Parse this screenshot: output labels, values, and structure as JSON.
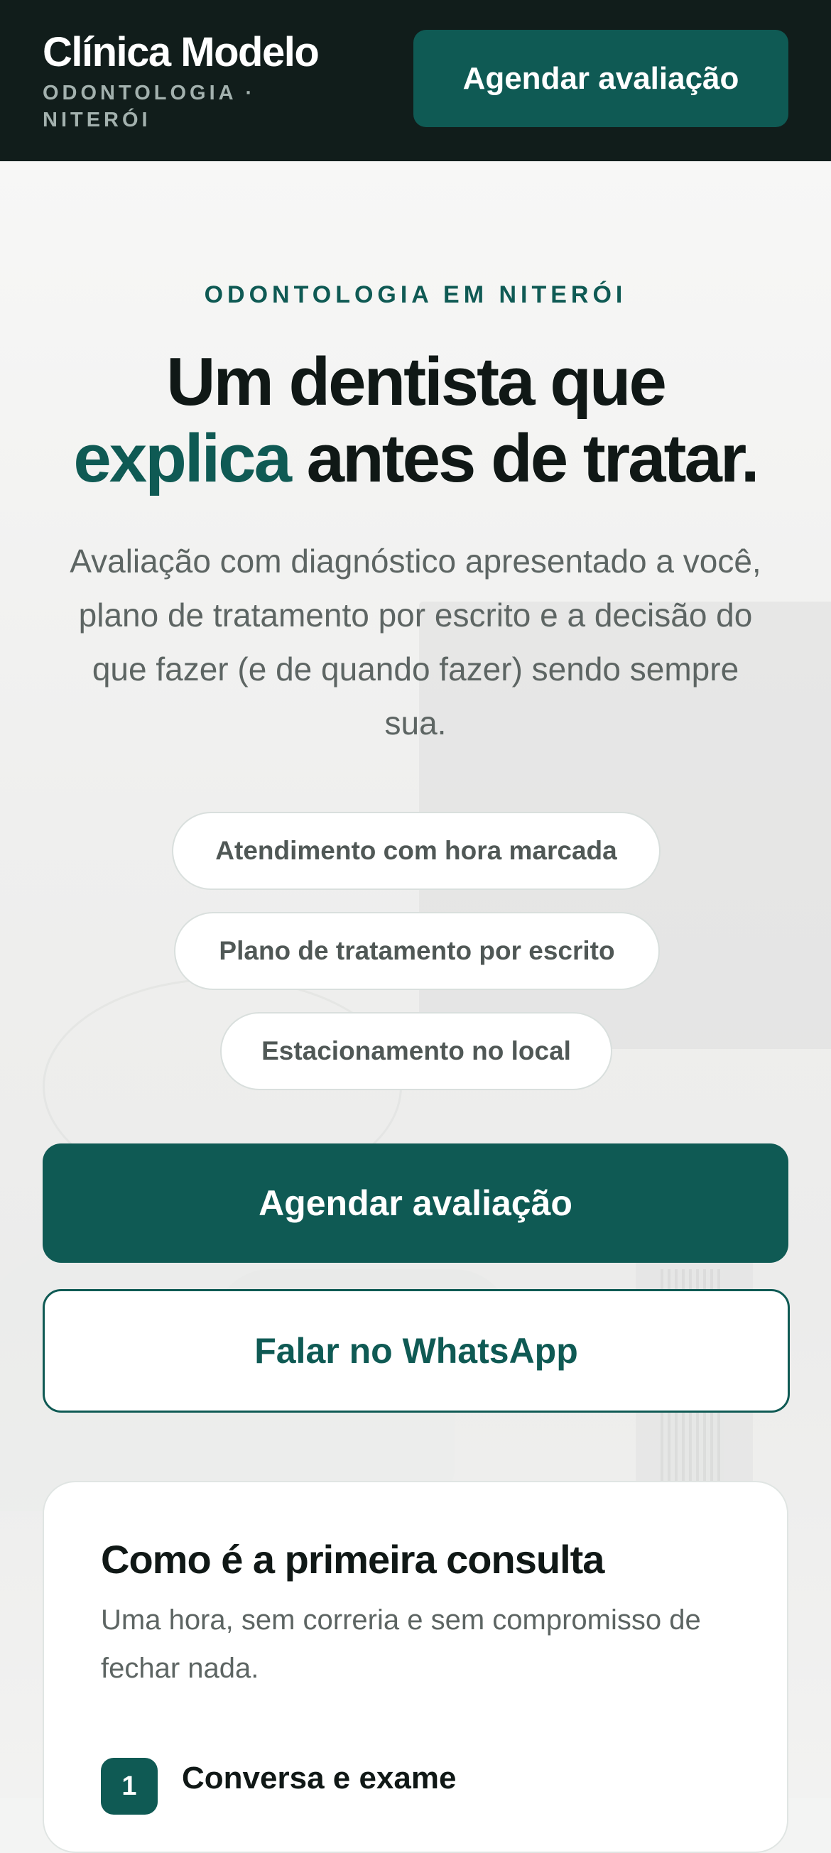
{
  "header": {
    "brand_name": "Clínica Modelo",
    "brand_subtitle": "ODONTOLOGIA · NITERÓI",
    "cta_label": "Agendar avaliação"
  },
  "hero": {
    "eyebrow": "ODONTOLOGIA EM NITERÓI",
    "headline_line1": "Um dentista que",
    "headline_accent": "explica",
    "headline_rest": " antes de tratar.",
    "lead": "Avaliação com diagnóstico apresentado a você, plano de tratamento por escrito e a decisão do que fazer (e de quando fazer) sendo sempre sua.",
    "pills": [
      "Atendimento com hora marcada",
      "Plano de tratamento por escrito",
      "Estacionamento no local"
    ],
    "primary_cta": "Agendar avaliação",
    "secondary_cta": "Falar no WhatsApp"
  },
  "first_visit": {
    "title": "Como é a primeira consulta",
    "subtitle": "Uma hora, sem correria e sem compromisso de fechar nada.",
    "steps": [
      {
        "number": "1",
        "title": "Conversa e exame"
      }
    ]
  },
  "colors": {
    "brand_dark": "#111d1b",
    "accent": "#0f5a54"
  }
}
